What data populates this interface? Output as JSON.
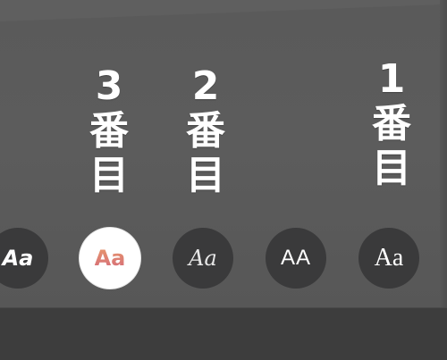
{
  "labels": [
    {
      "num": "3",
      "line1": "番",
      "line2": "目"
    },
    {
      "num": "2",
      "line1": "番",
      "line2": "目"
    },
    {
      "num": "1",
      "line1": "番",
      "line2": "目"
    }
  ],
  "font_styles": [
    {
      "sample": "Aa",
      "name": "bold-italic",
      "selected": false
    },
    {
      "sample": "Aa",
      "name": "rounded-gradient",
      "selected": true
    },
    {
      "sample": "Aa",
      "name": "serif-italic",
      "selected": false
    },
    {
      "sample": "AA",
      "name": "uppercase-sans",
      "selected": false
    },
    {
      "sample": "Aa",
      "name": "serif-regular",
      "selected": false
    }
  ],
  "colors": {
    "selected_text_gradient": [
      "#e89a6b",
      "#d46a7a"
    ],
    "circle_background": "#3a3a3b",
    "selected_background": "#ffffff"
  }
}
